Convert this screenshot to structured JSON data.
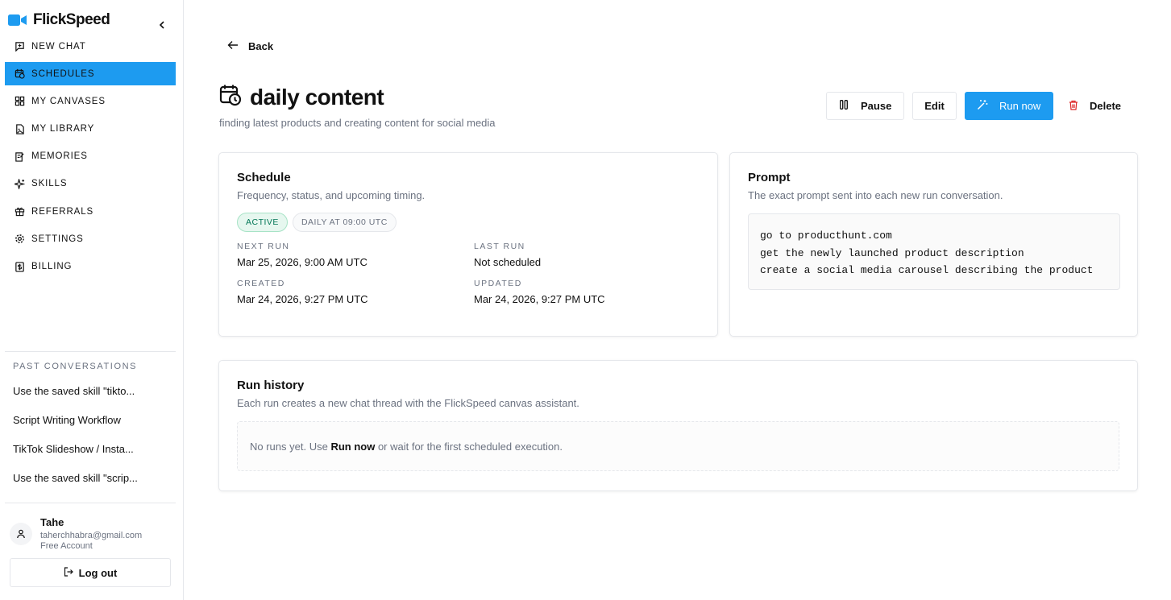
{
  "brand": {
    "name": "FlickSpeed",
    "icon": "video-camera-icon",
    "accent": "#1d9bf0"
  },
  "sidebar": {
    "items": [
      {
        "label": "NEW CHAT",
        "icon": "chat-plus-icon",
        "active": false
      },
      {
        "label": "SCHEDULES",
        "icon": "calendar-clock-icon",
        "active": true
      },
      {
        "label": "MY CANVASES",
        "icon": "grid-icon",
        "active": false
      },
      {
        "label": "MY LIBRARY",
        "icon": "file-image-icon",
        "active": false
      },
      {
        "label": "MEMORIES",
        "icon": "notebook-pen-icon",
        "active": false
      },
      {
        "label": "SKILLS",
        "icon": "sparkles-icon",
        "active": false
      },
      {
        "label": "REFERRALS",
        "icon": "gift-icon",
        "active": false
      },
      {
        "label": "SETTINGS",
        "icon": "gear-icon",
        "active": false
      },
      {
        "label": "BILLING",
        "icon": "dollar-icon",
        "active": false
      }
    ],
    "past_title": "PAST CONVERSATIONS",
    "past": [
      "Use the saved skill \"tikto...",
      "Script Writing Workflow",
      "TikTok Slideshow / Insta...",
      "Use the saved skill \"scrip..."
    ],
    "user": {
      "name": "Tahe",
      "email": "taherchhabra@gmail.com",
      "plan": "Free Account"
    },
    "logout": "Log out"
  },
  "header": {
    "back": "Back",
    "title": "daily content",
    "subtitle": "finding latest products and creating content for social media",
    "actions": {
      "pause": "Pause",
      "edit": "Edit",
      "run": "Run now",
      "delete": "Delete"
    }
  },
  "schedule": {
    "title": "Schedule",
    "desc": "Frequency, status, and upcoming timing.",
    "status": "ACTIVE",
    "frequency": "DAILY AT 09:00 UTC",
    "next_run_label": "NEXT RUN",
    "next_run": "Mar 25, 2026, 9:00 AM UTC",
    "last_run_label": "LAST RUN",
    "last_run": "Not scheduled",
    "created_label": "CREATED",
    "created": "Mar 24, 2026, 9:27 PM UTC",
    "updated_label": "UPDATED",
    "updated": "Mar 24, 2026, 9:27 PM UTC"
  },
  "prompt": {
    "title": "Prompt",
    "desc": "The exact prompt sent into each new run conversation.",
    "lines": [
      "go to producthunt.com",
      "get the newly launched product description",
      "create a social media carousel describing the product"
    ]
  },
  "history": {
    "title": "Run history",
    "desc": "Each run creates a new chat thread with the FlickSpeed canvas assistant.",
    "empty_prefix": "No runs yet. Use ",
    "empty_link": "Run now",
    "empty_suffix": " or wait for the first scheduled execution."
  }
}
